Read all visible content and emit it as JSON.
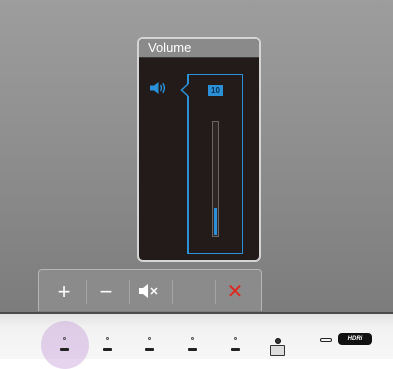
{
  "osd": {
    "title": "Volume",
    "value": "10",
    "level_fraction": 0.24,
    "icon": "speaker-icon",
    "accent_color": "#2a90d8"
  },
  "button_bar": {
    "buttons": [
      {
        "name": "plus",
        "icon": "plus-icon",
        "glyph": "+"
      },
      {
        "name": "minus",
        "icon": "minus-icon",
        "glyph": "−"
      },
      {
        "name": "mute",
        "icon": "mute-icon",
        "glyph": ""
      },
      {
        "name": "blank",
        "icon": "",
        "glyph": ""
      },
      {
        "name": "close",
        "icon": "close-icon",
        "glyph": "✕",
        "color": "#e0281e"
      }
    ]
  },
  "bezel": {
    "logo_text": "HDRi"
  }
}
